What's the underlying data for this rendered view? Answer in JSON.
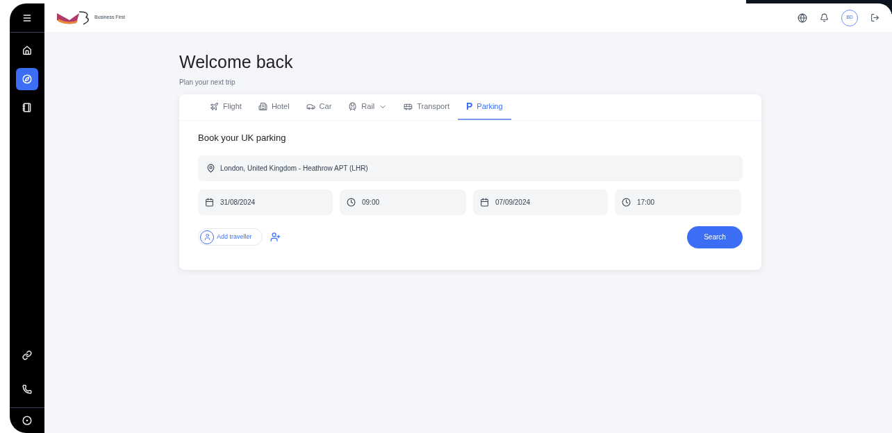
{
  "sidebar": {
    "top_items": [
      {
        "kind": "menu",
        "selected": false
      },
      {
        "kind": "home",
        "selected": false
      },
      {
        "kind": "compass",
        "selected": true
      },
      {
        "kind": "book",
        "selected": false
      }
    ],
    "bottom_items": [
      {
        "kind": "link",
        "selected": false
      },
      {
        "kind": "phone",
        "selected": false
      },
      {
        "kind": "circle",
        "selected": false
      }
    ]
  },
  "header": {
    "logo_text": "Business First",
    "avatar": "BD"
  },
  "welcome": {
    "title": "Welcome back",
    "subtitle": "Plan your next trip"
  },
  "tabs": [
    {
      "kind": "plane",
      "label": "Flight",
      "selected": false
    },
    {
      "kind": "building",
      "label": "Hotel",
      "selected": false
    },
    {
      "kind": "car",
      "label": "Car",
      "selected": false
    },
    {
      "kind": "train",
      "label": "Rail",
      "selected": false,
      "dropdown": true
    },
    {
      "kind": "bus",
      "label": "Transport",
      "selected": false
    },
    {
      "kind": "glyph",
      "glyph": "P",
      "label": "Parking",
      "selected": true
    }
  ],
  "form": {
    "title": "Book your UK parking",
    "location": "London, United Kingdom - Heathrow APT (LHR)",
    "fields": [
      {
        "kind": "date",
        "value": "31/08/2024"
      },
      {
        "kind": "time",
        "value": "09:00"
      },
      {
        "kind": "date",
        "value": "07/09/2024"
      },
      {
        "kind": "time",
        "value": "17:00"
      }
    ],
    "add_traveller": "Add traveller",
    "search": "Search"
  }
}
